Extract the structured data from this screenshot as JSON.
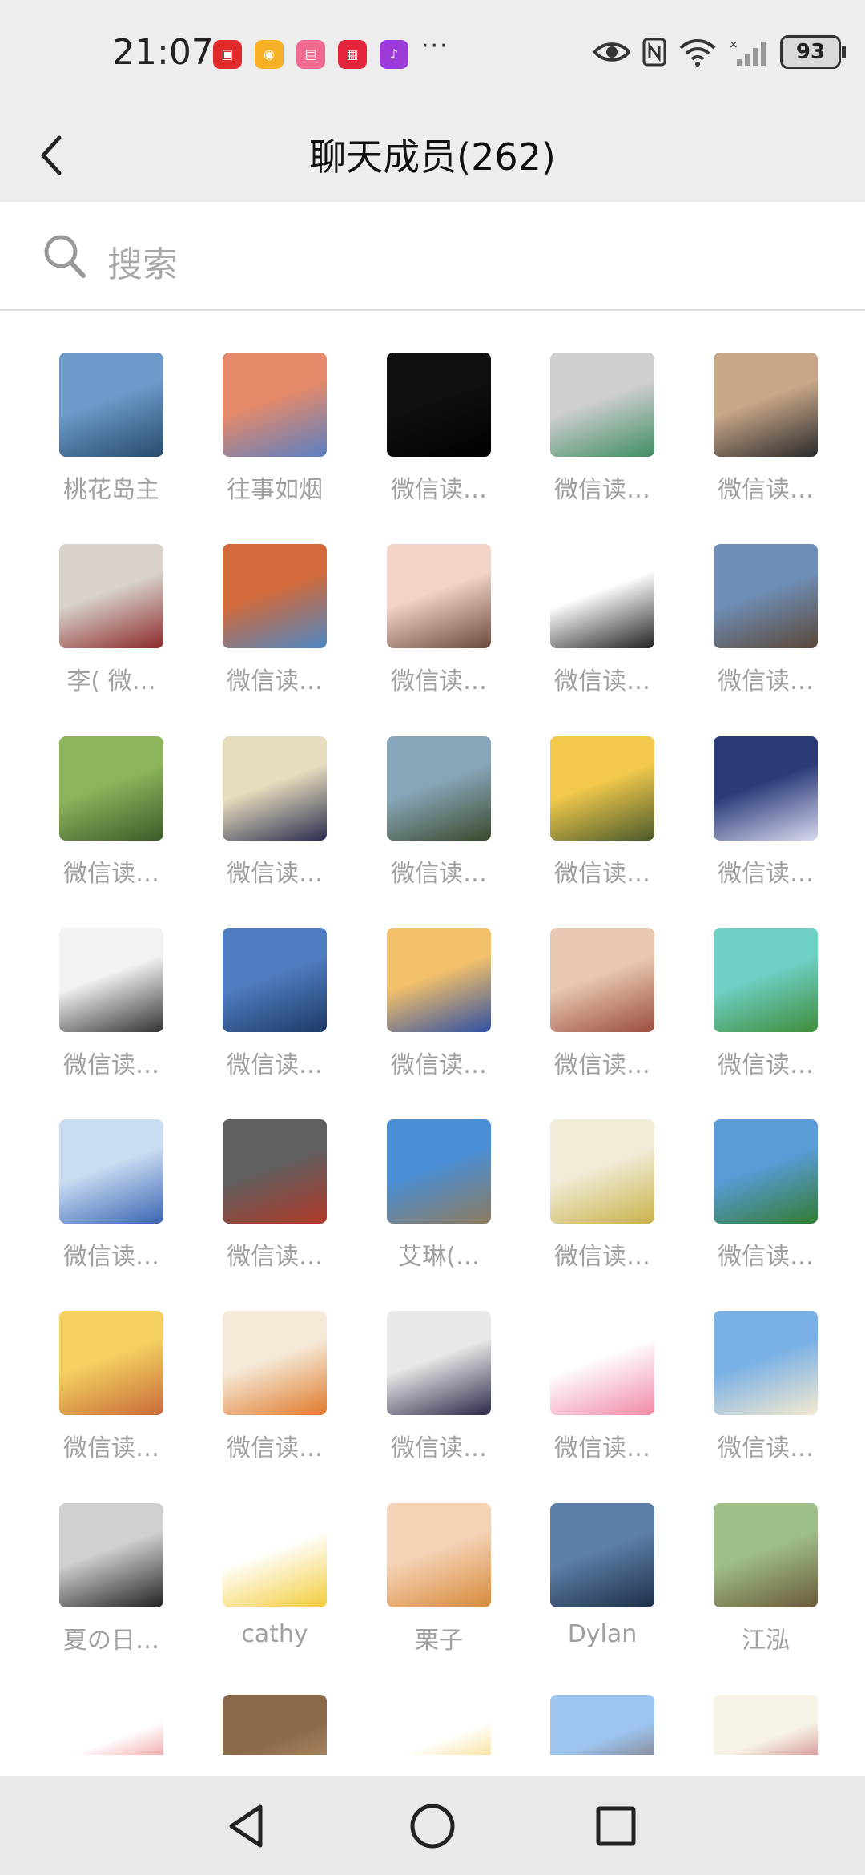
{
  "status_bar": {
    "time": "21:07",
    "battery": "93",
    "app_icons": [
      {
        "name": "huawei-app-icon",
        "color": "#e02a2a",
        "glyph": "▣"
      },
      {
        "name": "weibo-app-icon",
        "color": "#f5b025",
        "glyph": "◉"
      },
      {
        "name": "bilibili-app-icon",
        "color": "#f06a8f",
        "glyph": "▤"
      },
      {
        "name": "xiaohongshu-app-icon",
        "color": "#e2233a",
        "glyph": "▦"
      },
      {
        "name": "music-app-icon",
        "color": "#9b3ad6",
        "glyph": "♪"
      }
    ],
    "more": "···"
  },
  "header": {
    "title": "聊天成员(262)"
  },
  "search": {
    "placeholder": "搜索"
  },
  "members": [
    {
      "name": "桃花岛主",
      "c1": "#6d9ac9",
      "c2": "#274b6a"
    },
    {
      "name": "往事如烟",
      "c1": "#e58a6a",
      "c2": "#5a7fc3"
    },
    {
      "name": "微信读…",
      "c1": "#101010",
      "c2": "#000000"
    },
    {
      "name": "微信读…",
      "c1": "#cfcfcf",
      "c2": "#3f8d63"
    },
    {
      "name": "微信读…",
      "c1": "#c9a789",
      "c2": "#2b2b2b"
    },
    {
      "name": "李( 微…",
      "c1": "#d9d3cc",
      "c2": "#8b2a2a"
    },
    {
      "name": "微信读…",
      "c1": "#d26a3b",
      "c2": "#4c87c4"
    },
    {
      "name": "微信读…",
      "c1": "#f1d3c8",
      "c2": "#6a4a3a"
    },
    {
      "name": "微信读…",
      "c1": "#ffffff",
      "c2": "#222222"
    },
    {
      "name": "微信读…",
      "c1": "#6f8fb8",
      "c2": "#5b4738"
    },
    {
      "name": "微信读…",
      "c1": "#8fb55c",
      "c2": "#3d5b2a"
    },
    {
      "name": "微信读…",
      "c1": "#e7ddbe",
      "c2": "#2a2d4f"
    },
    {
      "name": "微信读…",
      "c1": "#88a6b9",
      "c2": "#3b4a2d"
    },
    {
      "name": "微信读…",
      "c1": "#f2c94c",
      "c2": "#4a5a2b"
    },
    {
      "name": "微信读…",
      "c1": "#2a3b78",
      "c2": "#d9d9ef"
    },
    {
      "name": "微信读…",
      "c1": "#f2f2f2",
      "c2": "#333333"
    },
    {
      "name": "微信读…",
      "c1": "#4f7dc2",
      "c2": "#1e3a66"
    },
    {
      "name": "微信读…",
      "c1": "#f2c06a",
      "c2": "#2f4fa3"
    },
    {
      "name": "微信读…",
      "c1": "#e8c8b2",
      "c2": "#9b4d3f"
    },
    {
      "name": "微信读…",
      "c1": "#6fd0c6",
      "c2": "#3f8d3a"
    },
    {
      "name": "微信读…",
      "c1": "#c9dcf2",
      "c2": "#3b64b3"
    },
    {
      "name": "微信读…",
      "c1": "#5f5f5f",
      "c2": "#b23a2a"
    },
    {
      "name": "艾琳(…",
      "c1": "#4b8fd6",
      "c2": "#8c7a5c"
    },
    {
      "name": "微信读…",
      "c1": "#f0ecd8",
      "c2": "#c9b24a"
    },
    {
      "name": "微信读…",
      "c1": "#5a9bd8",
      "c2": "#2f7d32"
    },
    {
      "name": "微信读…",
      "c1": "#f3d060",
      "c2": "#c96b3a"
    },
    {
      "name": "微信读…",
      "c1": "#f5ead8",
      "c2": "#e07a2c"
    },
    {
      "name": "微信读…",
      "c1": "#e8e8e8",
      "c2": "#2a2a4a"
    },
    {
      "name": "微信读…",
      "c1": "#ffffff",
      "c2": "#f08aa6"
    },
    {
      "name": "微信读…",
      "c1": "#79b0e6",
      "c2": "#f5ead0"
    },
    {
      "name": "夏の日…",
      "c1": "#d0d0d0",
      "c2": "#222222"
    },
    {
      "name": "cathy",
      "c1": "#ffffff",
      "c2": "#f2cc3a"
    },
    {
      "name": "栗子",
      "c1": "#f4d2b5",
      "c2": "#d88a3a"
    },
    {
      "name": "Dylan",
      "c1": "#5d7fa8",
      "c2": "#1f2f48"
    },
    {
      "name": "江泓",
      "c1": "#9fbf8a",
      "c2": "#6b5a3a"
    },
    {
      "name": "",
      "c1": "#ffffff",
      "c2": "#e24a4a"
    },
    {
      "name": "",
      "c1": "#8a6a4a",
      "c2": "#caa27a"
    },
    {
      "name": "",
      "c1": "#ffffff",
      "c2": "#f2c230"
    },
    {
      "name": "",
      "c1": "#9ec5ef",
      "c2": "#6a4a3a"
    },
    {
      "name": "",
      "c1": "#f7f3e4",
      "c2": "#b33a4a"
    }
  ],
  "nav": {
    "back": "back-triangle",
    "home": "home-circle",
    "recent": "recent-square"
  }
}
